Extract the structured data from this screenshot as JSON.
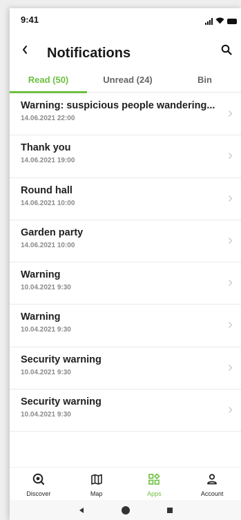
{
  "status": {
    "time": "9:41"
  },
  "header": {
    "title": "Notifications"
  },
  "tabs": [
    {
      "label": "Read (50)",
      "active": true
    },
    {
      "label": "Unread (24)",
      "active": false
    },
    {
      "label": "Bin",
      "active": false
    }
  ],
  "notifications": [
    {
      "title": "Warning: suspicious people wandering...",
      "date": "14.06.2021 22:00"
    },
    {
      "title": "Thank you",
      "date": "14.06.2021 19:00"
    },
    {
      "title": "Round hall",
      "date": "14.06.2021 10:00"
    },
    {
      "title": "Garden party",
      "date": "14.06.2021 10:00"
    },
    {
      "title": "Warning",
      "date": "10.04.2021 9:30"
    },
    {
      "title": "Warning",
      "date": "10.04.2021 9:30"
    },
    {
      "title": "Security warning",
      "date": "10.04.2021 9:30"
    },
    {
      "title": "Security warning",
      "date": "10.04.2021 9:30"
    }
  ],
  "bottom_nav": [
    {
      "label": "Discover",
      "icon": "discover-icon"
    },
    {
      "label": "Map",
      "icon": "map-icon"
    },
    {
      "label": "Apps",
      "icon": "apps-icon",
      "active": true
    },
    {
      "label": "Account",
      "icon": "account-icon"
    }
  ],
  "colors": {
    "accent": "#6cbf3f",
    "text": "#1f1f1f",
    "muted": "#8a8a8a"
  }
}
